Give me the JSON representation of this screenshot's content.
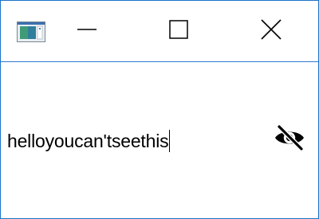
{
  "window": {
    "title_icon": "app-window-icon",
    "controls": {
      "minimize_icon": "minimize-icon",
      "maximize_icon": "maximize-icon",
      "close_icon": "close-icon"
    }
  },
  "password_field": {
    "value": "helloyoucan'tseethis",
    "visibility_toggle_icon": "eye-off-icon"
  },
  "colors": {
    "window_border": "#1a73c8",
    "titlebar_divider": "#2b7bd0"
  }
}
